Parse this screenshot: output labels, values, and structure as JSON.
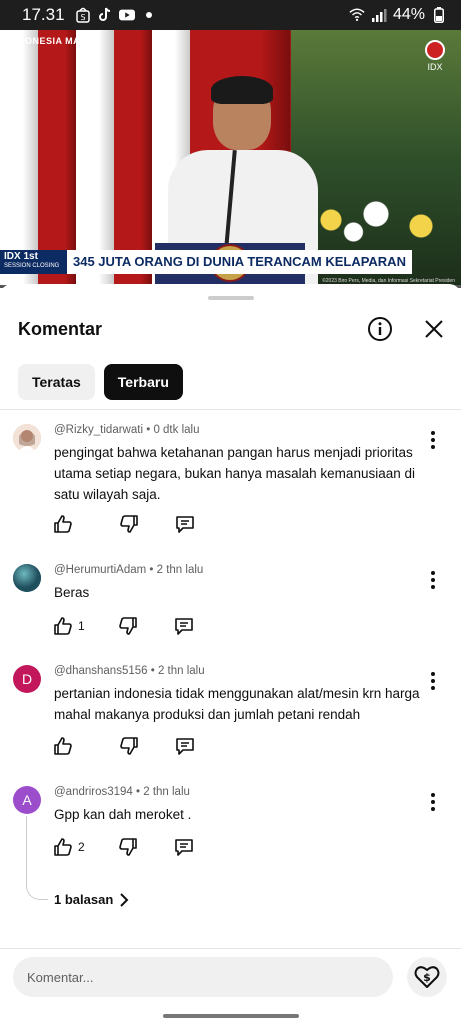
{
  "status_bar": {
    "time": "17.31",
    "battery": "44%"
  },
  "video": {
    "brand_left": "INDONESIA MAJU",
    "brand_right": "IDX",
    "lower_third_label": "IDX 1st",
    "lower_third_sub": "SESSION CLOSING",
    "headline": "345 JUTA ORANG DI DUNIA TERANCAM KELAPARAN",
    "credit": "©2023 Biro Pers, Media, dan Informasi Sekretariat Presiden"
  },
  "comments_sheet": {
    "title": "Komentar",
    "chips": [
      {
        "label": "Teratas",
        "active": false
      },
      {
        "label": "Terbaru",
        "active": true
      }
    ],
    "comments": [
      {
        "user": "@Rizky_tidarwati",
        "time": "0 dtk lalu",
        "text": "pengingat bahwa ketahanan pangan harus menjadi prioritas utama setiap negara, bukan hanya masalah kemanusiaan di satu wilayah saja.",
        "likes": "",
        "avatar_letter": "",
        "avatar_color": "#e8c4b0"
      },
      {
        "user": "@HerumurtiAdam",
        "time": "2 thn lalu",
        "text": "Beras",
        "likes": "1",
        "avatar_letter": "",
        "avatar_color": "#2f7f8a"
      },
      {
        "user": "@dhanshans5156",
        "time": "2 thn lalu",
        "text": "pertanian indonesia tidak menggunakan alat/mesin krn harga mahal makanya produksi dan jumlah petani rendah",
        "likes": "",
        "avatar_letter": "D",
        "avatar_color": "#c2185b"
      },
      {
        "user": "@andriros3194",
        "time": "2 thn lalu",
        "text": "Gpp kan dah meroket .",
        "likes": "2",
        "avatar_letter": "A",
        "avatar_color": "#9c4dcc",
        "replies": "1 balasan"
      }
    ],
    "input_placeholder": "Komentar..."
  }
}
